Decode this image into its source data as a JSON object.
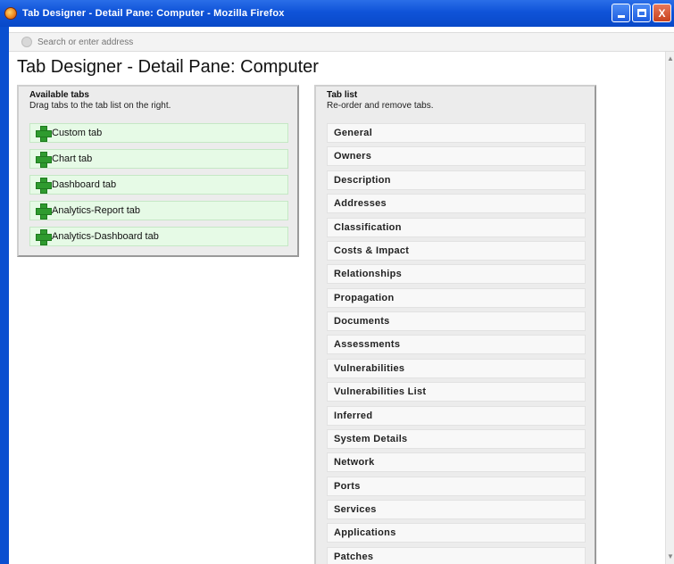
{
  "window": {
    "title": "Tab Designer - Detail Pane: Computer - Mozilla Firefox",
    "buttons": {
      "minimize": "_",
      "maximize": "□",
      "close": "X"
    }
  },
  "address_bar": {
    "placeholder": "Search or enter address"
  },
  "page": {
    "title": "Tab Designer - Detail Pane: Computer"
  },
  "available_tabs": {
    "heading": "Available tabs",
    "subtitle": "Drag tabs to the tab list on the right.",
    "items": [
      {
        "label": "Custom tab"
      },
      {
        "label": "Chart tab"
      },
      {
        "label": "Dashboard tab"
      },
      {
        "label": "Analytics-Report tab"
      },
      {
        "label": "Analytics-Dashboard tab"
      }
    ]
  },
  "tab_list": {
    "heading": "Tab list",
    "subtitle": "Re-order and remove tabs.",
    "items": [
      {
        "label": "General"
      },
      {
        "label": "Owners"
      },
      {
        "label": "Description"
      },
      {
        "label": "Addresses"
      },
      {
        "label": "Classification"
      },
      {
        "label": "Costs & Impact"
      },
      {
        "label": "Relationships"
      },
      {
        "label": "Propagation"
      },
      {
        "label": "Documents"
      },
      {
        "label": "Assessments"
      },
      {
        "label": "Vulnerabilities"
      },
      {
        "label": "Vulnerabilities List"
      },
      {
        "label": "Inferred"
      },
      {
        "label": "System Details"
      },
      {
        "label": "Network"
      },
      {
        "label": "Ports"
      },
      {
        "label": "Services"
      },
      {
        "label": "Applications"
      },
      {
        "label": "Patches"
      }
    ]
  },
  "colors": {
    "titlebar": "#0f53d8",
    "available_item_bg": "#e6fae6",
    "plus_icon": "#2f9b2f",
    "panel_bg": "#ececec",
    "tab_item_bg": "#f8f8f8"
  }
}
